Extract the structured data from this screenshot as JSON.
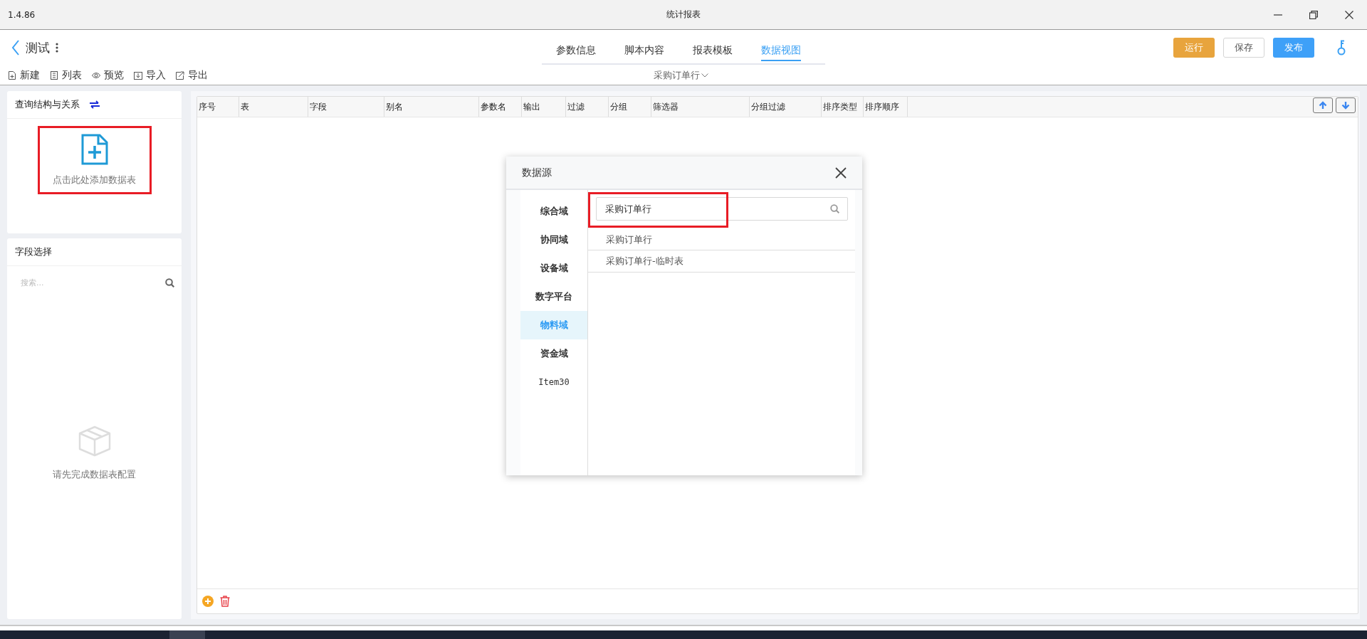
{
  "window": {
    "version": "1.4.86",
    "title": "统计报表"
  },
  "header": {
    "back_title": "测试",
    "tabs": [
      {
        "label": "参数信息",
        "selected": false
      },
      {
        "label": "脚本内容",
        "selected": false
      },
      {
        "label": "报表模板",
        "selected": false
      },
      {
        "label": "数据视图",
        "selected": true
      }
    ],
    "buttons": [
      {
        "label": "运行",
        "kind": "warning"
      },
      {
        "label": "保存",
        "kind": "default"
      },
      {
        "label": "发布",
        "kind": "primary"
      }
    ]
  },
  "toolbar": {
    "items": [
      "新建",
      "列表",
      "预览",
      "导入",
      "导出"
    ],
    "current_table": "采购订单行"
  },
  "query_panel": {
    "title": "查询结构与关系",
    "add_label": "点击此处添加数据表",
    "highlighted": true
  },
  "field_panel": {
    "title": "字段选择",
    "search": {
      "placeholder": "搜索..."
    },
    "empty_text": "请先完成数据表配置"
  },
  "table": {
    "columns": [
      "序号",
      "表",
      "字段",
      "别名",
      "参数名",
      "输出",
      "过滤",
      "分组",
      "筛选器",
      "分组过滤",
      "排序类型",
      "排序顺序"
    ]
  },
  "dialog": {
    "title": "数据源",
    "categories": [
      {
        "label": "综合域",
        "selected": false
      },
      {
        "label": "协同域",
        "selected": false
      },
      {
        "label": "设备域",
        "selected": false
      },
      {
        "label": "数字平台",
        "selected": false
      },
      {
        "label": "物料域",
        "selected": true
      },
      {
        "label": "资金域",
        "selected": false
      },
      {
        "label": "Item30",
        "selected": false
      }
    ],
    "search": {
      "value": "采购订单行",
      "highlighted": true
    },
    "results": [
      "采购订单行",
      "采购订单行-临时表"
    ]
  }
}
